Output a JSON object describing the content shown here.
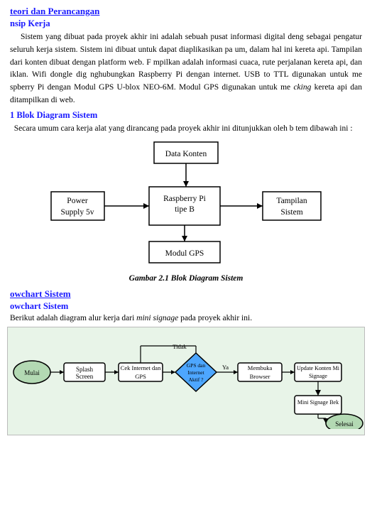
{
  "page": {
    "section_title": "teori dan Perancangan",
    "prinsip_kerja": {
      "title": "nsip Kerja",
      "paragraph1": "Sistem yang dibuat pada proyek akhir ini adalah sebuah pusat informasi digital deng sebagai pengatur seluruh kerja sistem. Sistem ini dibuat untuk dapat diaplikasikan pa um, dalam hal ini kereta api. Tampilan dari konten dibuat dengan platform web. F mpilkan adalah informasi cuaca, rute perjalanan kereta api, dan iklan. Wifi dongle dig nghubungkan Raspberry Pi dengan internet. USB to TTL digunakan untuk me spberry Pi dengan Modul GPS U-blox NEO-6M. Modul GPS digunakan untuk me cking kereta api dan ditampilkan di web."
    },
    "blok_diagram": {
      "title": "1 Blok Diagram Sistem",
      "intro": "Secara umum cara kerja alat yang dirancang pada proyek akhir ini ditunjukkan oleh b tem dibawah ini :",
      "nodes": {
        "data_konten": "Data Konten",
        "raspberry": "Raspberry Pi\ntipe B",
        "tampilan": "Tampilan\nSistem",
        "power": "Power\nSupply 5v",
        "modul_gps": "Modul GPS"
      },
      "caption": "Gambar 2.1  Blok Diagram Sistem"
    },
    "flowchart": {
      "section_title": "owchart Sistem",
      "subtitle": "owchart Sistem",
      "desc_prefix": "Berikut adalah diagram alur kerja dari ",
      "desc_italic": "mini signage",
      "desc_suffix": " pada proyek akhir ini.",
      "nodes": {
        "mulai": "Mulai",
        "splash_screen": "Splash Screen",
        "cek_internet": "Cek Internet dan GPS",
        "diamond": "GPS dan\nInternet\nAktif ?",
        "tidak": "Tidak",
        "ya": "Ya",
        "membuka_browser": "Membuka Browser",
        "update_konten": "Update Konten Mi Signage",
        "mini_signage": "Mini Signage Bek",
        "selesai": "Selesai"
      }
    }
  }
}
